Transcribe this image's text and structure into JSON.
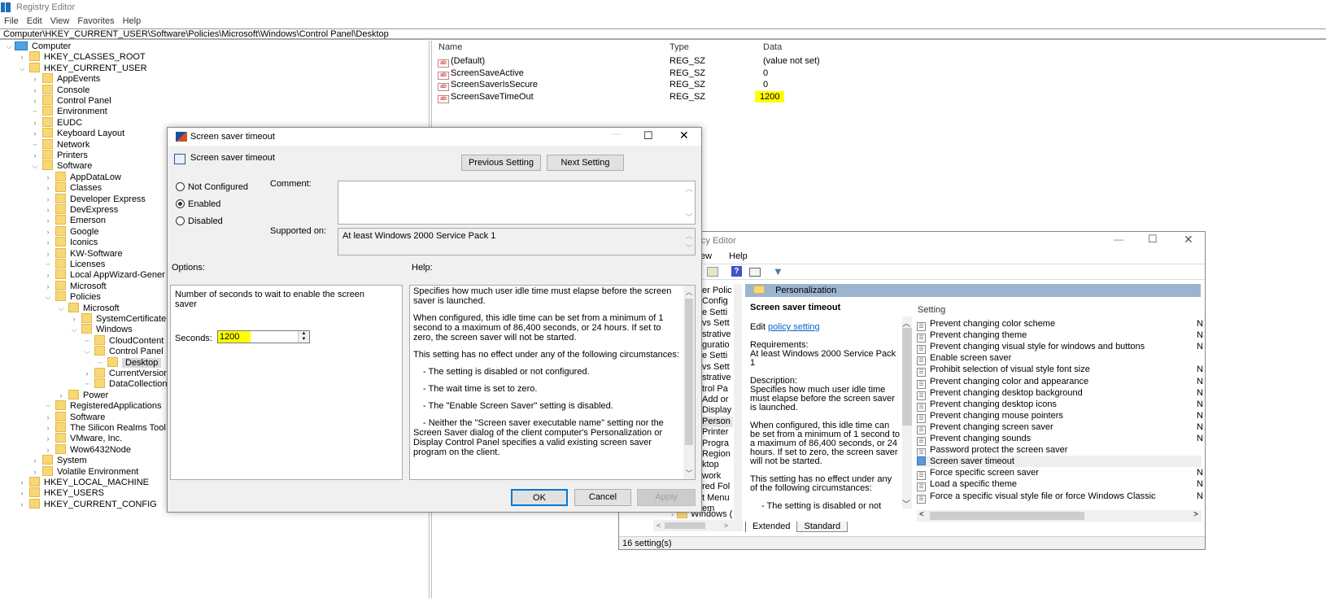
{
  "app": {
    "title": "Registry Editor"
  },
  "menu": [
    "File",
    "Edit",
    "View",
    "Favorites",
    "Help"
  ],
  "address": "Computer\\HKEY_CURRENT_USER\\Software\\Policies\\Microsoft\\Windows\\Control Panel\\Desktop",
  "tree": [
    {
      "label": "Computer",
      "level": 0,
      "expander": "open",
      "icon": "computer"
    },
    {
      "label": "HKEY_CLASSES_ROOT",
      "level": 1,
      "expander": "closed"
    },
    {
      "label": "HKEY_CURRENT_USER",
      "level": 1,
      "expander": "open"
    },
    {
      "label": "AppEvents",
      "level": 2,
      "expander": "closed"
    },
    {
      "label": "Console",
      "level": 2,
      "expander": "closed"
    },
    {
      "label": "Control Panel",
      "level": 2,
      "expander": "closed"
    },
    {
      "label": "Environment",
      "level": 2,
      "expander": "none"
    },
    {
      "label": "EUDC",
      "level": 2,
      "expander": "closed"
    },
    {
      "label": "Keyboard Layout",
      "level": 2,
      "expander": "closed"
    },
    {
      "label": "Network",
      "level": 2,
      "expander": "none"
    },
    {
      "label": "Printers",
      "level": 2,
      "expander": "closed"
    },
    {
      "label": "Software",
      "level": 2,
      "expander": "open"
    },
    {
      "label": "AppDataLow",
      "level": 3,
      "expander": "closed"
    },
    {
      "label": "Classes",
      "level": 3,
      "expander": "closed"
    },
    {
      "label": "Developer Express",
      "level": 3,
      "expander": "closed"
    },
    {
      "label": "DevExpress",
      "level": 3,
      "expander": "closed"
    },
    {
      "label": "Emerson",
      "level": 3,
      "expander": "closed"
    },
    {
      "label": "Google",
      "level": 3,
      "expander": "closed"
    },
    {
      "label": "Iconics",
      "level": 3,
      "expander": "closed"
    },
    {
      "label": "KW-Software",
      "level": 3,
      "expander": "closed"
    },
    {
      "label": "Licenses",
      "level": 3,
      "expander": "none"
    },
    {
      "label": "Local AppWizard-Gener",
      "level": 3,
      "expander": "closed"
    },
    {
      "label": "Microsoft",
      "level": 3,
      "expander": "closed"
    },
    {
      "label": "Policies",
      "level": 3,
      "expander": "open"
    },
    {
      "label": "Microsoft",
      "level": 4,
      "expander": "open"
    },
    {
      "label": "SystemCertificate",
      "level": 5,
      "expander": "closed"
    },
    {
      "label": "Windows",
      "level": 5,
      "expander": "open"
    },
    {
      "label": "CloudContent",
      "level": 6,
      "expander": "none"
    },
    {
      "label": "Control Panel",
      "level": 6,
      "expander": "open"
    },
    {
      "label": "Desktop",
      "level": 7,
      "expander": "none",
      "selected": true
    },
    {
      "label": "CurrentVersion",
      "level": 6,
      "expander": "closed"
    },
    {
      "label": "DataCollection",
      "level": 6,
      "expander": "none"
    },
    {
      "label": "Power",
      "level": 4,
      "expander": "closed"
    },
    {
      "label": "RegisteredApplications",
      "level": 3,
      "expander": "none"
    },
    {
      "label": "Software",
      "level": 3,
      "expander": "closed"
    },
    {
      "label": "The Silicon Realms Tool",
      "level": 3,
      "expander": "closed"
    },
    {
      "label": "VMware, Inc.",
      "level": 3,
      "expander": "closed"
    },
    {
      "label": "Wow6432Node",
      "level": 3,
      "expander": "closed"
    },
    {
      "label": "System",
      "level": 2,
      "expander": "closed"
    },
    {
      "label": "Volatile Environment",
      "level": 2,
      "expander": "closed"
    },
    {
      "label": "HKEY_LOCAL_MACHINE",
      "level": 1,
      "expander": "closed"
    },
    {
      "label": "HKEY_USERS",
      "level": 1,
      "expander": "closed"
    },
    {
      "label": "HKEY_CURRENT_CONFIG",
      "level": 1,
      "expander": "closed"
    }
  ],
  "values": {
    "headers": {
      "name": "Name",
      "type": "Type",
      "data": "Data"
    },
    "rows": [
      {
        "name": "(Default)",
        "type": "REG_SZ",
        "data": "(value not set)"
      },
      {
        "name": "ScreenSaveActive",
        "type": "REG_SZ",
        "data": "0"
      },
      {
        "name": "ScreenSaverIsSecure",
        "type": "REG_SZ",
        "data": "0"
      },
      {
        "name": "ScreenSaveTimeOut",
        "type": "REG_SZ",
        "data": "1200",
        "highlight": true
      }
    ]
  },
  "dialog": {
    "title": "Screen saver timeout",
    "heading": "Screen saver timeout",
    "prev": "Previous Setting",
    "next": "Next Setting",
    "radios": {
      "not_configured": "Not Configured",
      "enabled": "Enabled",
      "disabled": "Disabled",
      "selected": "enabled"
    },
    "comment_label": "Comment:",
    "comment_value": "",
    "supported_label": "Supported on:",
    "supported_value": "At least Windows 2000 Service Pack 1",
    "options_label": "Options:",
    "help_label": "Help:",
    "option_desc": "Number of seconds to wait to enable the screen saver",
    "seconds_label": "Seconds:",
    "seconds_value": "1200",
    "help": [
      "Specifies how much user idle time must elapse before the screen saver is launched.",
      "When configured, this idle time can be set from a minimum of 1 second to a maximum of 86,400 seconds, or 24 hours. If set to zero, the screen saver will not be started.",
      "This setting has no effect under any of the following circumstances:",
      "   - The setting is disabled or not configured.",
      "   - The wait time is set to zero.",
      "   - The \"Enable Screen Saver\" setting is disabled.",
      "   - Neither the \"Screen saver executable name\" setting nor the Screen Saver dialog of the client computer's Personalization or Display Control Panel specifies a valid existing screen saver program on the client."
    ],
    "ok": "OK",
    "cancel": "Cancel",
    "apply": "Apply"
  },
  "gpe": {
    "title": "licy Editor",
    "menu": [
      "ew",
      "Help"
    ],
    "tree_items": [
      "er Polic",
      "Config",
      "e Setti",
      "vs Sett",
      "strative",
      "guratio",
      "e Setti",
      "vs Sett",
      "strative",
      "trol Pa",
      "Add or",
      "Display",
      "Person",
      "Printer",
      "Progra",
      "Region",
      "ktop",
      "work",
      "red Fol",
      "t Menu",
      "em"
    ],
    "tree_last": "Windows (",
    "category": "Personalization",
    "detail": {
      "title": "Screen saver timeout",
      "edit_prefix": "Edit",
      "edit_link": "policy setting",
      "req_label": "Requirements:",
      "req_value": "At least Windows 2000 Service Pack 1",
      "desc_label": "Description:",
      "desc_1": "Specifies how much user idle time must elapse before the screen saver is launched.",
      "desc_2": "When configured, this idle time can be set from a minimum of 1 second to a maximum of 86,400 seconds, or 24 hours. If set to zero, the screen saver will not be started.",
      "desc_3": "This setting has no effect under any of the following circumstances:",
      "desc_4": "- The setting is disabled or not"
    },
    "setting_header": "Setting",
    "settings": [
      {
        "label": "Prevent changing color scheme",
        "state": "N"
      },
      {
        "label": "Prevent changing theme",
        "state": "N"
      },
      {
        "label": "Prevent changing visual style for windows and buttons",
        "state": "N"
      },
      {
        "label": "Enable screen saver",
        "state": ""
      },
      {
        "label": "Prohibit selection of visual style font size",
        "state": "N"
      },
      {
        "label": "Prevent changing color and appearance",
        "state": "N"
      },
      {
        "label": "Prevent changing desktop background",
        "state": "N"
      },
      {
        "label": "Prevent changing desktop icons",
        "state": "N"
      },
      {
        "label": "Prevent changing mouse pointers",
        "state": "N"
      },
      {
        "label": "Prevent changing screen saver",
        "state": "N"
      },
      {
        "label": "Prevent changing sounds",
        "state": "N"
      },
      {
        "label": "Password protect the screen saver",
        "state": ""
      },
      {
        "label": "Screen saver timeout",
        "state": "",
        "selected": true
      },
      {
        "label": "Force specific screen saver",
        "state": "N"
      },
      {
        "label": "Load a specific theme",
        "state": "N"
      },
      {
        "label": "Force a specific visual style file or force Windows Classic",
        "state": "N"
      }
    ],
    "tabs": [
      "Extended",
      "Standard"
    ],
    "status": "16 setting(s)"
  }
}
